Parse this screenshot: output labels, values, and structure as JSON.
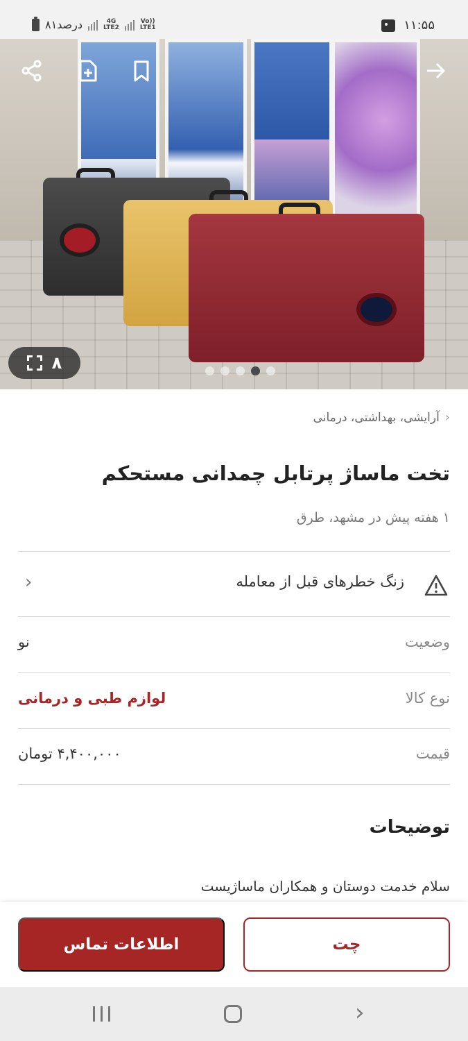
{
  "status_bar": {
    "battery_text": "۸۱درصد",
    "net1": "4G",
    "net1_sub": "LTE2",
    "net2": "Vo))",
    "net2_sub": "LTE1",
    "time": "۱۱:۵۵"
  },
  "gallery": {
    "image_count": "۸",
    "total_dots": 5,
    "active_dot": 4
  },
  "breadcrumb": {
    "text": "آرایشی، بهداشتی، درمانی"
  },
  "listing": {
    "title": "تخت ماساژ پرتابل چمدانی مستحکم",
    "subtitle": "۱ هفته پیش در مشهد، طرق"
  },
  "warning": {
    "text": "زنگ خطرهای قبل از معامله"
  },
  "details": [
    {
      "label": "وضعیت",
      "value": "نو"
    },
    {
      "label": "نوع کالا",
      "value": "لوازم طبی و درمانی"
    },
    {
      "label": "قیمت",
      "value": "۴,۴۰۰,۰۰۰ تومان"
    }
  ],
  "description": {
    "title": "توضیحات",
    "text": "سلام خدمت دوستان و همکاران ماساژیست"
  },
  "actions": {
    "contact_label": "اطلاعات تماس",
    "chat_label": "چت"
  },
  "colors": {
    "accent": "#a62626"
  }
}
